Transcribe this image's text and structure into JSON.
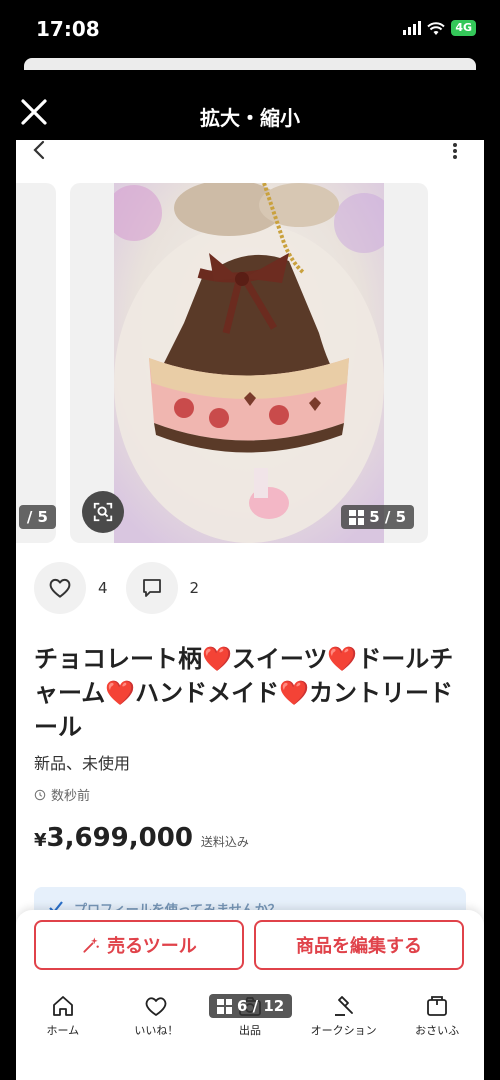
{
  "status_bar": {
    "time": "17:08",
    "network": "4G"
  },
  "viewer": {
    "title": "拡大・縮小"
  },
  "carousel": {
    "prev_badge": "/ 5",
    "main_badge": "5 / 5"
  },
  "actions": {
    "likes": "4",
    "comments": "2"
  },
  "item": {
    "title_parts": [
      "チョコレート柄",
      "スイーツ",
      "ドールチャーム",
      "ハンドメイド",
      "カントリードール"
    ],
    "heart": "❤️",
    "condition": "新品、未使用",
    "posted": "数秒前",
    "price_yen": "¥",
    "price": "3,699,000",
    "shipping": "送料込み"
  },
  "promo": {
    "text": "プロフィールを使ってみませんか？"
  },
  "buttons": {
    "sell_tool": "売るツール",
    "edit_item": "商品を編集する"
  },
  "tabs": [
    {
      "label": "ホーム",
      "icon": "home-icon"
    },
    {
      "label": "いいね！",
      "icon": "heart-icon"
    },
    {
      "label": "出品",
      "icon": "camera-icon"
    },
    {
      "label": "オークション",
      "icon": "gavel-icon"
    },
    {
      "label": "おさいふ",
      "icon": "wallet-icon"
    }
  ],
  "page_indicator": "6 / 12",
  "colors": {
    "accent": "#e0424a",
    "dark_header": "#000000",
    "battery": "#34c759"
  }
}
